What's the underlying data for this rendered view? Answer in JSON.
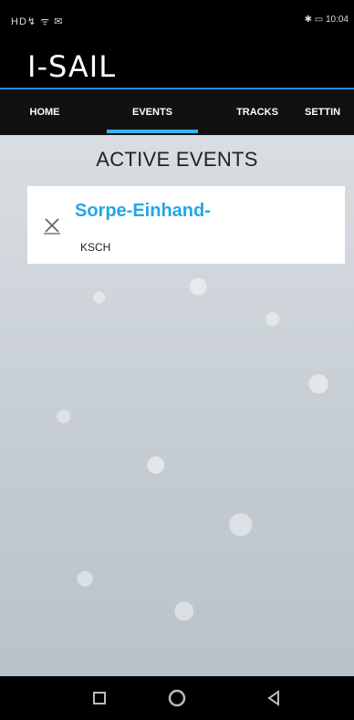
{
  "status_bar": {
    "left": "HD↯ ᯤ ✉",
    "right": "✱ ▭ 10:04"
  },
  "app": {
    "title": "I-SAIL",
    "accent_color": "#1f8fd1"
  },
  "tabs": [
    {
      "label": "HOME",
      "active": false
    },
    {
      "label": "EVENTS",
      "active": true
    },
    {
      "label": "TRACKS",
      "active": false
    },
    {
      "label": "SETTIN",
      "active": false
    }
  ],
  "main": {
    "heading": "ACTIVE EVENTS",
    "events": [
      {
        "title": "Sorpe-Einhand-",
        "subtitle": "KSCH",
        "icon": "sail-icon"
      }
    ]
  },
  "nav": {
    "recent_icon": "square-icon",
    "home_icon": "circle-icon",
    "back_icon": "triangle-back-icon"
  }
}
